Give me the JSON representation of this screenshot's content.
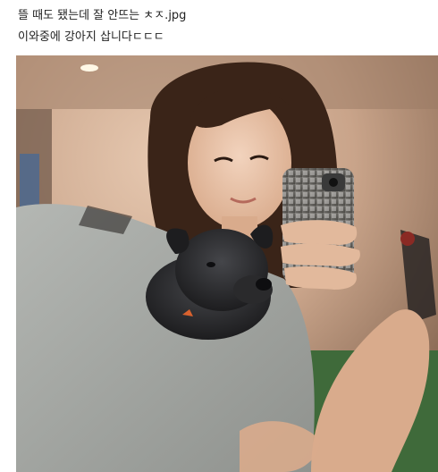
{
  "post": {
    "lines": [
      "뜰 때도 됐는데 잘 안뜨는 ㅊㅈ.jpg",
      "이와중에 강아지 삽니다ㄷㄷㄷ"
    ]
  },
  "photo": {
    "subject": "mirror selfie of a woman holding a small black puppy",
    "colors": {
      "wall": "#c9a48a",
      "shirt": "#a3a6a2",
      "hair": "#3a2418",
      "skin": "#e9c3a8",
      "puppy": "#2c2c2e",
      "phone_case": "#6c6a66",
      "floor": "#3f6a3a"
    }
  }
}
